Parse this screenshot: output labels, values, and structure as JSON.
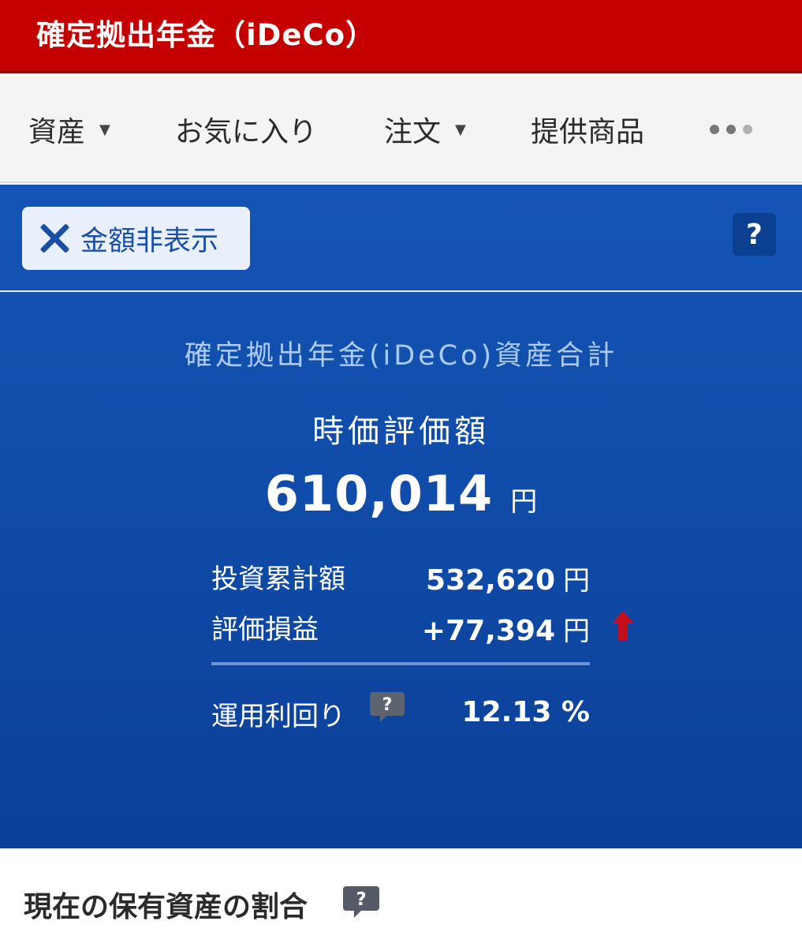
{
  "header": {
    "title": "確定拠出年金（iDeCo）"
  },
  "nav": {
    "items": [
      {
        "label": "資産",
        "caret": "▼"
      },
      {
        "label": "お気に入り"
      },
      {
        "label": "注文",
        "caret": "▼"
      },
      {
        "label": "提供商品"
      }
    ],
    "more_icon": "more-dots-icon"
  },
  "panel": {
    "hide_button_label": "金額非表示",
    "help_label": "?",
    "asset_title": "確定拠出年金(iDeCo)資産合計",
    "market_value_label": "時価評価額",
    "market_value": "610,014",
    "market_value_unit": "円",
    "investment_total_label": "投資累計額",
    "investment_total": "532,620",
    "investment_total_unit": "円",
    "pl_label": "評価損益",
    "pl_value": "+77,394",
    "pl_unit": "円",
    "yield_label": "運用利回り",
    "yield_value": "12.13 %",
    "colors": {
      "arrow_up": "#c4101c",
      "panel_bg": "#1555b5"
    }
  },
  "section": {
    "title": "現在の保有資産の割合"
  }
}
